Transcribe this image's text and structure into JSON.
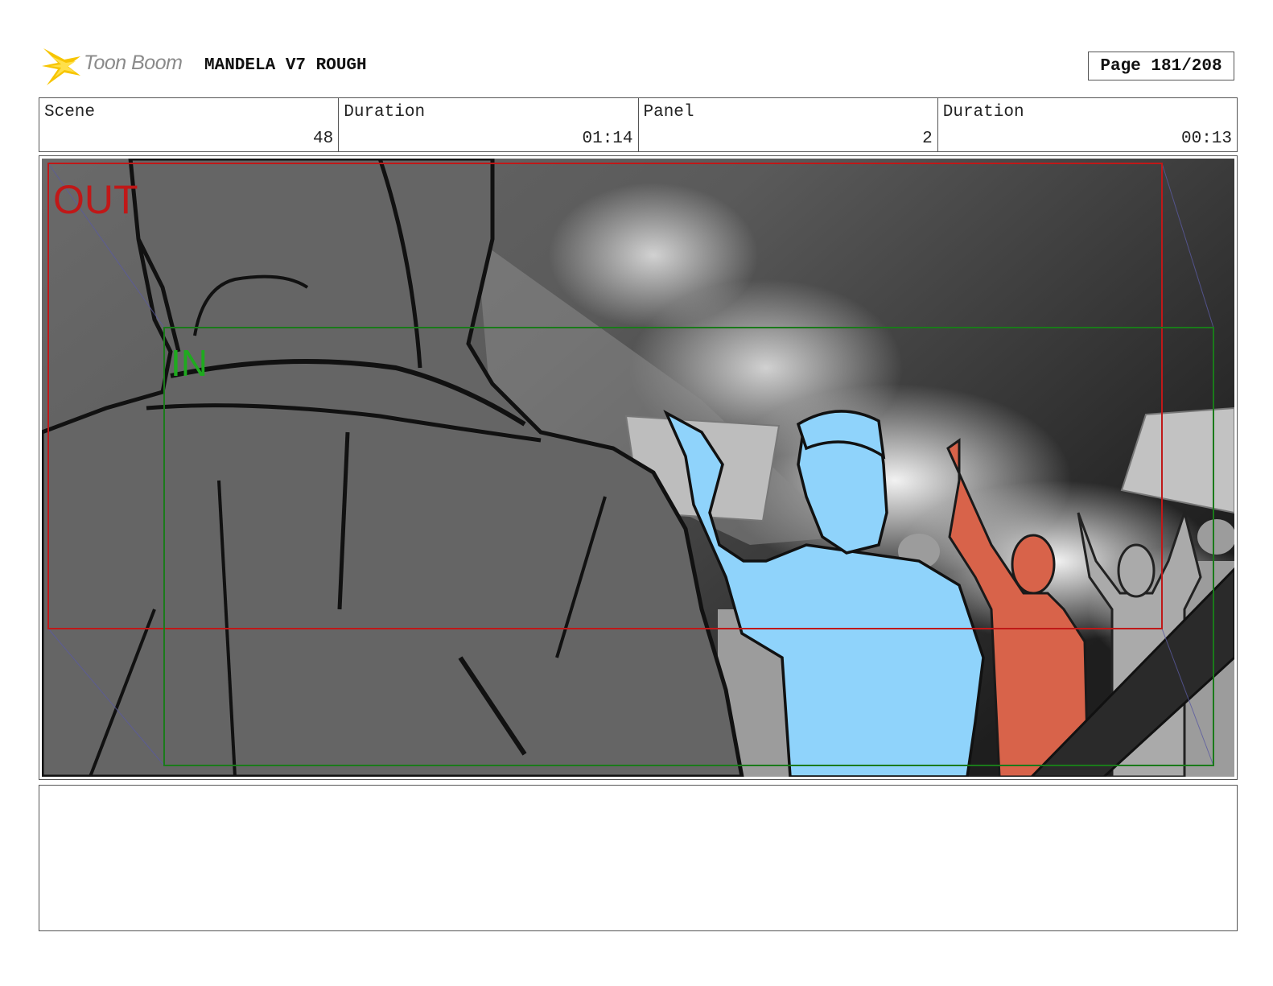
{
  "header": {
    "logo_text": "Toon Boom",
    "project_title": "MANDELA V7 ROUGH",
    "page_label": "Page 181/208"
  },
  "info": {
    "scene_label": "Scene",
    "scene_value": "48",
    "scene_duration_label": "Duration",
    "scene_duration_value": "01:14",
    "panel_label": "Panel",
    "panel_value": "2",
    "panel_duration_label": "Duration",
    "panel_duration_value": "00:13"
  },
  "panel": {
    "out_label": "OUT",
    "in_label": "IN",
    "colors": {
      "out_frame": "#c01818",
      "in_frame": "#1a7a1a",
      "blue_figure": "#8fd3fb",
      "red_figure": "#d8634a",
      "grey_figure": "#aaaaaa"
    }
  },
  "caption": {
    "text": ""
  }
}
